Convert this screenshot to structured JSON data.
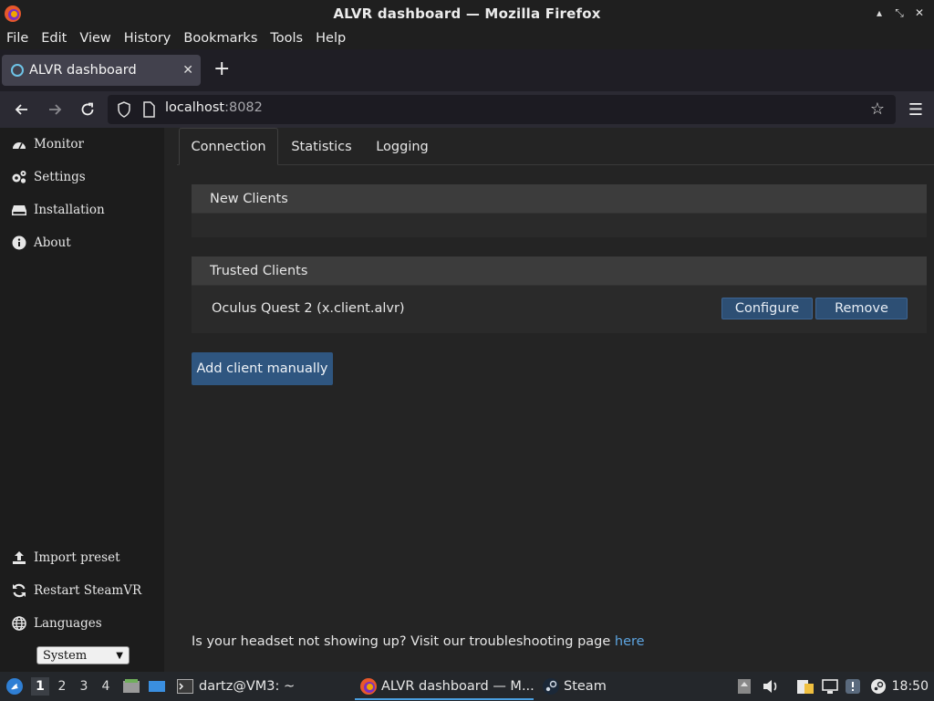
{
  "window": {
    "title": "ALVR dashboard — Mozilla Firefox"
  },
  "menu": {
    "items": [
      "File",
      "Edit",
      "View",
      "History",
      "Bookmarks",
      "Tools",
      "Help"
    ]
  },
  "browser_tab": {
    "title": "ALVR dashboard"
  },
  "address_bar": {
    "host": "localhost",
    "port": ":8082"
  },
  "sidebar": {
    "top_items": [
      {
        "label": "Monitor",
        "icon": "gauge-icon"
      },
      {
        "label": "Settings",
        "icon": "gears-icon"
      },
      {
        "label": "Installation",
        "icon": "drive-icon"
      },
      {
        "label": "About",
        "icon": "info-icon"
      }
    ],
    "bottom_items": [
      {
        "label": "Import preset",
        "icon": "upload-icon"
      },
      {
        "label": "Restart SteamVR",
        "icon": "refresh-icon"
      },
      {
        "label": "Languages",
        "icon": "globe-icon"
      }
    ],
    "language_value": "System"
  },
  "page_tabs": [
    "Connection",
    "Statistics",
    "Logging"
  ],
  "new_clients": {
    "title": "New Clients"
  },
  "trusted_clients": {
    "title": "Trusted Clients",
    "clients": [
      {
        "name": "Oculus Quest 2 (x.client.alvr)",
        "configure_label": "Configure",
        "remove_label": "Remove"
      }
    ]
  },
  "add_client_label": "Add client manually",
  "footer": {
    "text": "Is your headset not showing up? Visit our troubleshooting page ",
    "link": "here"
  },
  "taskbar": {
    "workspaces": [
      "1",
      "2",
      "3",
      "4"
    ],
    "terminal_label": "dartz@VM3: ~",
    "firefox_label": "ALVR dashboard — M...",
    "steam_label": "Steam",
    "clock": "18:50"
  },
  "colors": {
    "accent_button": "#2d4f74",
    "link": "#5da4e0",
    "taskbar_active": "#4a9fe0"
  }
}
